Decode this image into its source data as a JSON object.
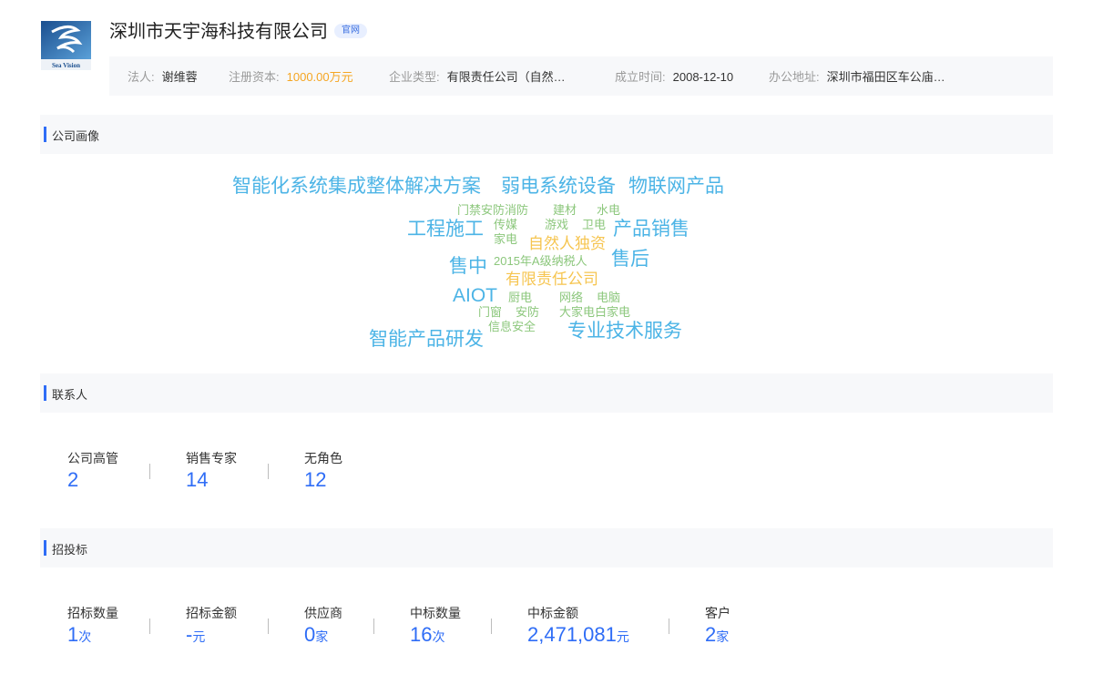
{
  "header": {
    "logo_text": "Sea Vision",
    "company_name": "深圳市天宇海科技有限公司",
    "official_tag": "官网",
    "info": {
      "legal_person_label": "法人:",
      "legal_person": "谢维蓉",
      "capital_label": "注册资本:",
      "capital": "1000.00万元",
      "type_label": "企业类型:",
      "type": "有限责任公司（自然…",
      "founded_label": "成立时间:",
      "founded": "2008-12-10",
      "address_label": "办公地址:",
      "address": "深圳市福田区车公庙…"
    }
  },
  "profile": {
    "title": "公司画像",
    "words": [
      {
        "text": "智能化系统集成整体解决方案",
        "color": "blue"
      },
      {
        "text": "弱电系统设备",
        "color": "blue"
      },
      {
        "text": "物联网产品",
        "color": "blue"
      },
      {
        "text": "门禁安防消防",
        "color": "green"
      },
      {
        "text": "建材",
        "color": "green"
      },
      {
        "text": "水电",
        "color": "green"
      },
      {
        "text": "工程施工",
        "color": "blue"
      },
      {
        "text": "传媒",
        "color": "green"
      },
      {
        "text": "游戏",
        "color": "green"
      },
      {
        "text": "卫电",
        "color": "green"
      },
      {
        "text": "产品销售",
        "color": "blue"
      },
      {
        "text": "家电",
        "color": "green"
      },
      {
        "text": "自然人独资",
        "color": "yellow"
      },
      {
        "text": "售中",
        "color": "blue"
      },
      {
        "text": "2015年A级纳税人",
        "color": "green"
      },
      {
        "text": "售后",
        "color": "blue"
      },
      {
        "text": "有限责任公司",
        "color": "yellow"
      },
      {
        "text": "AIOT",
        "color": "blue"
      },
      {
        "text": "厨电",
        "color": "green"
      },
      {
        "text": "网络",
        "color": "green"
      },
      {
        "text": "电脑",
        "color": "green"
      },
      {
        "text": "门窗",
        "color": "green"
      },
      {
        "text": "安防",
        "color": "green"
      },
      {
        "text": "大家电白家电",
        "color": "green"
      },
      {
        "text": "信息安全",
        "color": "green"
      },
      {
        "text": "智能产品研发",
        "color": "blue"
      },
      {
        "text": "专业技术服务",
        "color": "blue"
      }
    ]
  },
  "contacts": {
    "title": "联系人",
    "stats": [
      {
        "label": "公司高管",
        "value": "2"
      },
      {
        "label": "销售专家",
        "value": "14"
      },
      {
        "label": "无角色",
        "value": "12"
      }
    ]
  },
  "bidding": {
    "title": "招投标",
    "stats": [
      {
        "label": "招标数量",
        "value": "1",
        "unit": "次"
      },
      {
        "label": "招标金额",
        "value": "-",
        "unit": "元"
      },
      {
        "label": "供应商",
        "value": "0",
        "unit": "家"
      },
      {
        "label": "中标数量",
        "value": "16",
        "unit": "次"
      },
      {
        "label": "中标金额",
        "value": "2,471,081",
        "unit": "元"
      },
      {
        "label": "客户",
        "value": "2",
        "unit": "家"
      }
    ]
  }
}
